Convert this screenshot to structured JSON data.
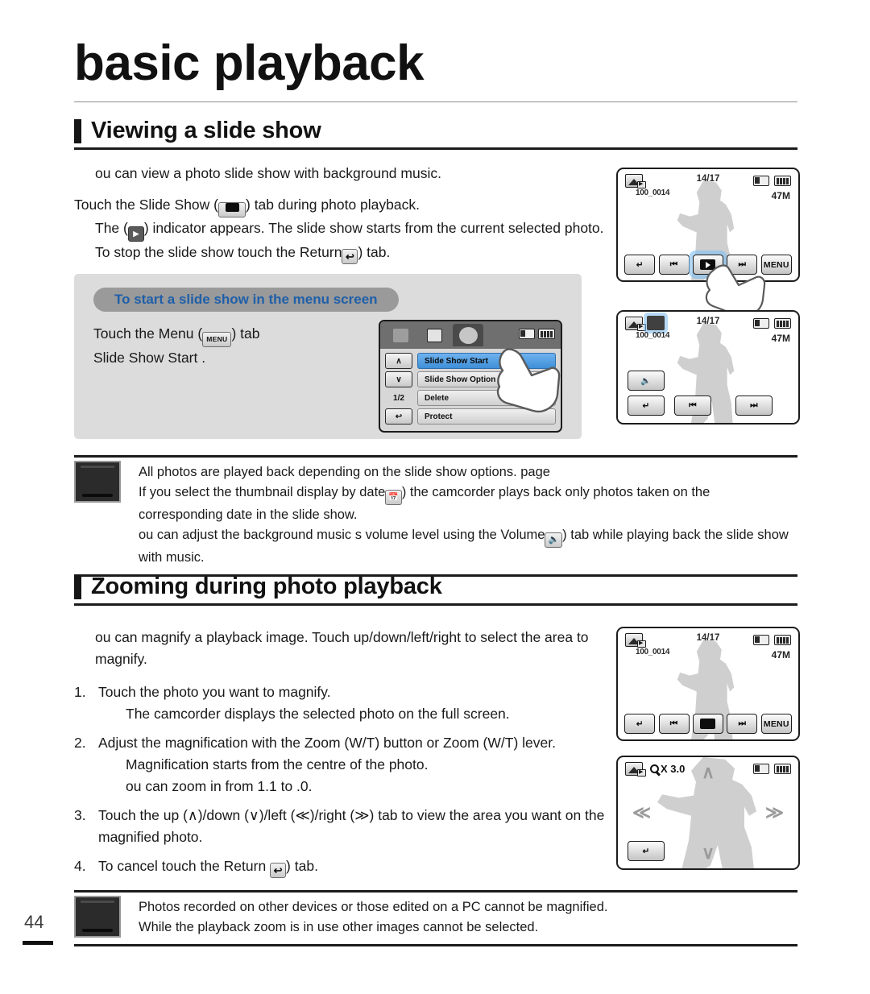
{
  "page": {
    "title": "basic playback",
    "number": "44"
  },
  "section1": {
    "heading": "Viewing a slide show",
    "intro": "ou can view a photo slide show with background music.",
    "step_main_pre": "Touch the Slide Show (",
    "step_main_post": ") tab during photo playback.",
    "sub1_pre": "The (",
    "sub1_post": ") indicator appears. The slide show starts from the current selected photo.",
    "sub2_pre": "To stop the slide show  touch the Return",
    "sub2_post": ") tab.",
    "callout": {
      "pill": "To start a slide show in the menu screen",
      "line1_pre": "Touch the Menu (",
      "line1_post": ") tab",
      "line2": "Slide Show Start ."
    },
    "note": {
      "line1": "All photos are played back depending on the slide show options. page",
      "line2_pre": "If you select the thumbnail display by date",
      "line2_post": ")  the camcorder plays back only photos taken on the corresponding date in the slide show.",
      "line3_pre": "ou can adjust the background music s volume level using the Volume",
      "line3_post": ") tab while playing back the slide show with music."
    }
  },
  "section2": {
    "heading": "Zooming during photo playback",
    "intro": "ou can magnify a playback image. Touch up/down/left/right to select the area to magnify.",
    "steps": [
      {
        "num": "1.",
        "text": "Touch the photo you want to magnify.",
        "subs": [
          "The camcorder displays the selected photo on the full screen."
        ]
      },
      {
        "num": "2.",
        "text": "Adjust the magnification with the Zoom (W/T) button or Zoom (W/T) lever.",
        "subs": [
          "Magnification starts from the centre of the photo.",
          "ou can zoom in from  1.1 to  .0."
        ]
      },
      {
        "num": "3.",
        "text": "Touch the up (∧)/down (∨)/left (≪)/right (≫) tab to view the area you want on the magnified photo.",
        "subs": []
      },
      {
        "num": "4.",
        "text": "To cancel  touch the Return ) tab.",
        "subs": []
      }
    ],
    "note": {
      "line1": "Photos recorded on other devices or those edited on a PC cannot be magnified.",
      "line2": "While the playback zoom is in use  other images cannot be selected."
    }
  },
  "chips": {
    "slideshow": "",
    "indicator": "",
    "return": "",
    "menu": "MENU",
    "volume": "",
    "date": ""
  },
  "lcd1": {
    "counter": "14/17",
    "file": "100_0014",
    "memory": "47M",
    "tabs": [
      "return",
      "prev",
      "slideshow",
      "next",
      "MENU"
    ],
    "menu_label": "MENU"
  },
  "lcd2": {
    "counter": "14/17",
    "file": "100_0014",
    "memory": "47M",
    "tabs": [
      "volume",
      "return",
      "prev",
      "next"
    ]
  },
  "lcd3": {
    "counter": "14/17",
    "file": "100_0014",
    "memory": "47M",
    "tabs": [
      "return",
      "prev",
      "stop",
      "next",
      "MENU"
    ],
    "menu_label": "MENU"
  },
  "lcd4": {
    "zoom_level": "X 3.0",
    "up": "∧",
    "down": "∨",
    "left": "≪",
    "right": "≫"
  },
  "menu_screen": {
    "page_indicator": "1/2",
    "up_arrow": "∧",
    "down_arrow": "∨",
    "return_arrow": "↩",
    "items": [
      "Slide Show Start",
      "Slide Show Option",
      "Delete",
      "Protect"
    ]
  },
  "colors": {
    "accent_blue": "#1f5fa8",
    "highlight": "#3f8fd8",
    "callout_bg": "#dcdcdc"
  }
}
